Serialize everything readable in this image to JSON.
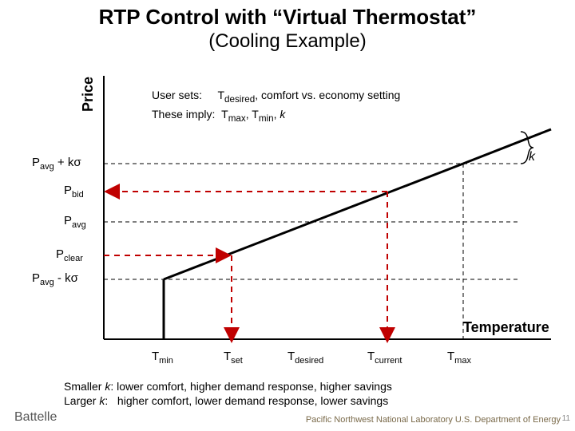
{
  "title": "RTP Control with “Virtual Thermostat”",
  "subtitle": "(Cooling Example)",
  "ylabel": "Price",
  "xlabel": "Temperature",
  "k_label": "k",
  "price_labels": {
    "p_avg_plus": "P<sub>avg</sub> + kσ",
    "p_bid": "P<sub>bid</sub>",
    "p_avg": "P<sub>avg</sub>",
    "p_clear": "P<sub>clear</sub>",
    "p_avg_minus": "P<sub>avg</sub> - kσ"
  },
  "temp_labels": {
    "t_min": "T<sub>min</sub>",
    "t_set": "T<sub>set</sub>",
    "t_desired": "T<sub>desired</sub>",
    "t_current": "T<sub>current</sub>",
    "t_max": "T<sub>max</sub>"
  },
  "user_text_line1": "User sets:     T<sub>desired</sub>, comfort vs. economy setting",
  "user_text_line2": "These imply:  T<sub>max</sub>, T<sub>min</sub>, <i>k</i>",
  "bottom_line1": "Smaller <i>k</i>: lower comfort, higher demand response, higher savings",
  "bottom_line2": "Larger <i>k</i>:   higher comfort, lower demand response, lower savings",
  "logo_left": "Battelle",
  "logo_right": "Pacific Northwest National Laboratory\nU.S. Department of Energy",
  "page_num": "11",
  "chart_data": {
    "type": "diagram",
    "title": "RTP Control with Virtual Thermostat (Cooling)",
    "x_axis": "Temperature",
    "y_axis": "Price",
    "y_levels_order_top_to_bottom": [
      "P_avg_plus_k_sigma",
      "P_bid",
      "P_avg",
      "P_clear",
      "P_avg_minus_k_sigma"
    ],
    "x_levels_order_left_to_right": [
      "T_min",
      "T_set",
      "T_desired",
      "T_current",
      "T_max"
    ],
    "bid_curve": "piecewise: vertical at T_min from y=0 up to P_avg_minus_k_sigma, then linear increasing to P_avg_plus_k_sigma at T_max",
    "red_dashed_paths": [
      "horizontal from y-axis at P_bid to x=T_current, arrow at left end",
      "vertical from (T_current, P_bid) down to x-axis, arrow at bottom",
      "horizontal from y-axis at P_clear to x=T_set, arrow at right end",
      "vertical from (T_set, P_clear) down to x-axis, arrow at bottom"
    ],
    "curly_brace": "between P_avg_plus_k_sigma and P_avg on right side labeled k (illustrative)"
  }
}
